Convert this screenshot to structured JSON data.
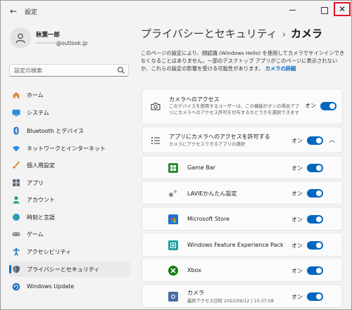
{
  "window": {
    "title": "設定",
    "back_glyph": "←",
    "close_glyph": "✕"
  },
  "user": {
    "name": "秋葉一郎",
    "email": "············@outlook.jp"
  },
  "search": {
    "placeholder": "設定の検索",
    "icon": "search-icon"
  },
  "sidebar": {
    "items": [
      {
        "label": "ホーム",
        "icon": "home-icon"
      },
      {
        "label": "システム",
        "icon": "system-icon"
      },
      {
        "label": "Bluetooth とデバイス",
        "icon": "bluetooth-icon"
      },
      {
        "label": "ネットワークとインターネット",
        "icon": "wifi-icon"
      },
      {
        "label": "個人用設定",
        "icon": "brush-icon"
      },
      {
        "label": "アプリ",
        "icon": "apps-icon"
      },
      {
        "label": "アカウント",
        "icon": "account-icon"
      },
      {
        "label": "時刻と言語",
        "icon": "globe-icon"
      },
      {
        "label": "ゲーム",
        "icon": "gamepad-icon"
      },
      {
        "label": "アクセシビリティ",
        "icon": "accessibility-icon"
      },
      {
        "label": "プライバシーとセキュリティ",
        "icon": "shield-icon",
        "selected": true
      },
      {
        "label": "Windows Update",
        "icon": "update-icon"
      }
    ]
  },
  "main": {
    "breadcrumb_parent": "プライバシーとセキュリティ",
    "breadcrumb_sep": "›",
    "breadcrumb_current": "カメラ",
    "description": "このページの設定により、顔認識 (Windows Hello) を使用してカメラでサインインできなくなることはありません。一部のデスクトップ アプリがこのページに表示されないか、これらの設定の影響を受ける可能性があります。",
    "description_link": "カメラの詳細",
    "camera_access": {
      "title": "カメラへのアクセス",
      "subtitle": "このデバイスを使用するユーザーは、この機能がオンの場合アプリにカメラへのアクセス許可を付与するかどうかを選択できます",
      "state": "オン"
    },
    "app_access": {
      "title": "アプリにカメラへのアクセスを許可する",
      "subtitle": "カメラにアクセスできるアプリの選択",
      "state": "オン",
      "chevron": "︿"
    },
    "apps": [
      {
        "name": "Game Bar",
        "state": "オン",
        "icon": "gamebar-icon",
        "color": "#2e8b3a"
      },
      {
        "name": "LAVIEかんたん設定",
        "state": "オン",
        "icon": "lavie-icon",
        "color": "#8a8a8a"
      },
      {
        "name": "Microsoft Store",
        "state": "オン",
        "icon": "store-icon",
        "color": "#1f6fd1"
      },
      {
        "name": "Windows Feature Experience Pack",
        "state": "オン",
        "icon": "feature-pack-icon",
        "color": "#1aa0a0"
      },
      {
        "name": "Xbox",
        "state": "オン",
        "icon": "xbox-icon",
        "color": "#107c10"
      },
      {
        "name": "カメラ",
        "sub": "最終アクセス日時 2022/09/12 | 10:37:58",
        "state": "オン",
        "icon": "camera-app-icon",
        "color": "#4a6fa5"
      }
    ]
  },
  "colors": {
    "accent": "#0067c0",
    "close_highlight": "#e81123"
  }
}
